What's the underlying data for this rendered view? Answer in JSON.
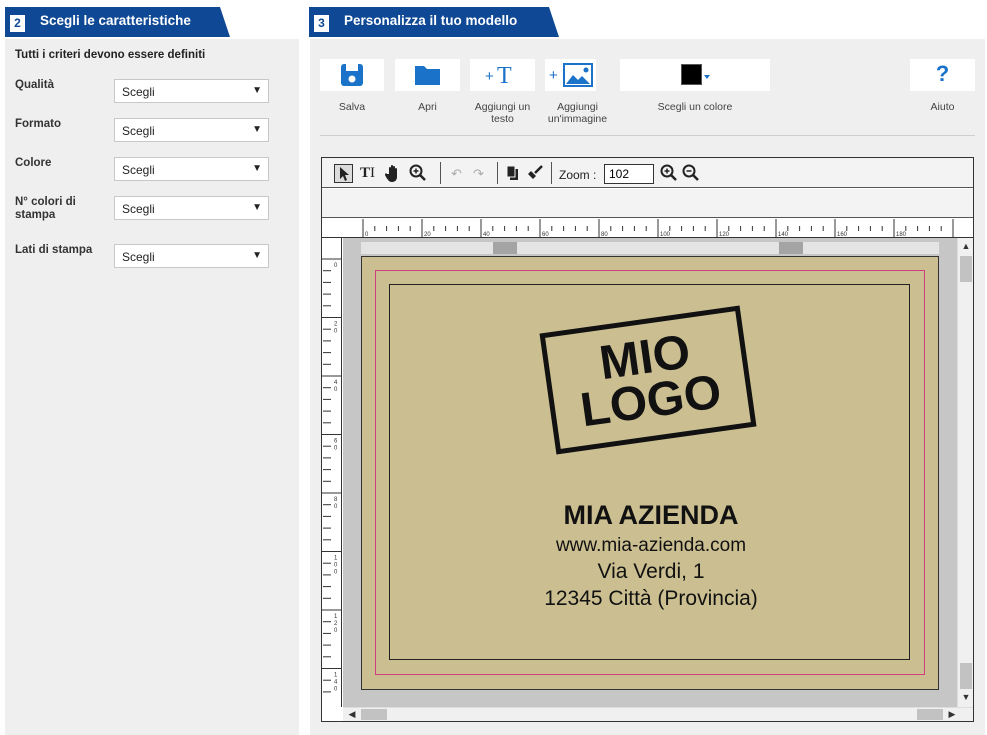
{
  "step2": {
    "number": "2",
    "title": "Scegli le caratteristiche",
    "note": "Tutti i criteri devono essere definiti",
    "criteria": [
      {
        "label": "Qualità",
        "value": "Scegli"
      },
      {
        "label": "Formato",
        "value": "Scegli"
      },
      {
        "label": "Colore",
        "value": "Scegli"
      },
      {
        "label": "N° colori di stampa",
        "value": "Scegli"
      },
      {
        "label": "Lati di stampa",
        "value": "Scegli"
      }
    ]
  },
  "step3": {
    "number": "3",
    "title": "Personalizza il tuo modello",
    "tools": [
      {
        "label": "Salva",
        "icon": "floppy-disk-icon"
      },
      {
        "label": "Apri",
        "icon": "folder-icon"
      },
      {
        "label": "Aggiungi un testo",
        "icon": "add-text-icon",
        "glyph": "+T"
      },
      {
        "label": "Aggiungi un'immagine",
        "icon": "add-image-icon",
        "glyph": "+"
      },
      {
        "label": "Scegli un colore",
        "icon": "color-swatch-icon"
      },
      {
        "label": "Aiuto",
        "icon": "help-icon",
        "glyph": "?"
      }
    ],
    "selected_color": "#000000"
  },
  "editor": {
    "zoom_label": "Zoom :",
    "zoom_value": "102",
    "ruler_h_labels": [
      "0",
      "20",
      "40",
      "60",
      "80",
      "100",
      "120",
      "140",
      "160",
      "180"
    ],
    "ruler_v_labels": [
      "0",
      "20",
      "40",
      "60",
      "80",
      "100",
      "120",
      "140"
    ],
    "logo_lines": [
      "MIO",
      "LOGO"
    ],
    "company": "MIA AZIENDA",
    "website": "www.mia-azienda.com",
    "street": "Via Verdi, 1",
    "city": "12345 Città (Provincia)"
  },
  "colors": {
    "brand_blue": "#0f4995",
    "icon_blue": "#1a73c8",
    "label_background": "#cbbf91",
    "safe_zone": "#d04080"
  }
}
